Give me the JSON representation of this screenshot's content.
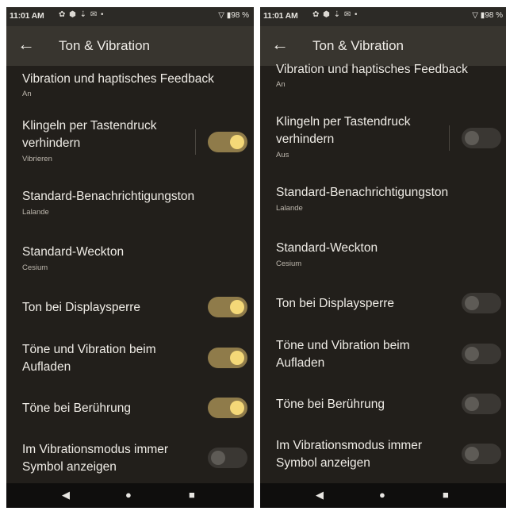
{
  "screens": [
    {
      "status": {
        "time": "11:01 AM",
        "battery": "98 %"
      },
      "appbar": {
        "title": "Ton & Vibration"
      },
      "rows": {
        "vibration": {
          "label": "Vibration und haptisches Feedback",
          "sub": "An"
        },
        "ring_block": {
          "label_line1": "Klingeln per Tastendruck",
          "label_line2": "verhindern",
          "sub": "Vibrieren",
          "on": true
        },
        "notification_tone": {
          "label": "Standard-Benachrichtigungston",
          "sub": "Lalande"
        },
        "alarm_tone": {
          "label": "Standard-Weckton",
          "sub": "Cesium"
        },
        "lock_sound": {
          "label": "Ton bei Displaysperre",
          "on": true
        },
        "charging": {
          "label_line1": "Töne und Vibration beim",
          "label_line2": "Aufladen",
          "on": true
        },
        "touch_sounds": {
          "label": "Töne bei Berührung",
          "on": true
        },
        "vibrate_icon": {
          "label_line1": "Im Vibrationsmodus immer",
          "label_line2": "Symbol anzeigen",
          "on": false
        }
      }
    },
    {
      "status": {
        "time": "11:01 AM",
        "battery": "98 %"
      },
      "appbar": {
        "title": "Ton & Vibration"
      },
      "rows": {
        "vibration": {
          "label": "Vibration und haptisches Feedback",
          "sub": "An"
        },
        "ring_block": {
          "label_line1": "Klingeln per Tastendruck",
          "label_line2": "verhindern",
          "sub": "Aus",
          "on": false
        },
        "notification_tone": {
          "label": "Standard-Benachrichtigungston",
          "sub": "Lalande"
        },
        "alarm_tone": {
          "label": "Standard-Weckton",
          "sub": "Cesium"
        },
        "lock_sound": {
          "label": "Ton bei Displaysperre",
          "on": false
        },
        "charging": {
          "label_line1": "Töne und Vibration beim",
          "label_line2": "Aufladen",
          "on": false
        },
        "touch_sounds": {
          "label": "Töne bei Berührung",
          "on": false
        },
        "vibrate_icon": {
          "label_line1": "Im Vibrationsmodus immer",
          "label_line2": "Symbol anzeigen",
          "on": false
        }
      }
    }
  ],
  "colors": {
    "toggle_on_track": "#8f7b4a",
    "toggle_on_knob": "#f4d878",
    "toggle_off_track": "#3a3733",
    "toggle_off_knob": "#5e5b56"
  },
  "icons": {
    "back": "arrow-left-icon",
    "nav": [
      "nav-back-icon",
      "nav-home-icon",
      "nav-recents-icon"
    ]
  }
}
